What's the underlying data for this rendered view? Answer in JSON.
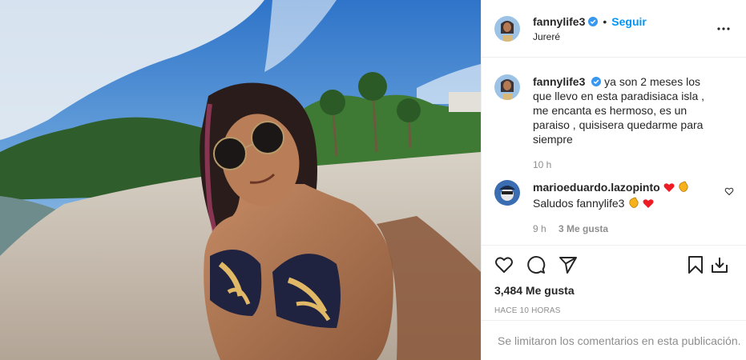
{
  "post": {
    "image_alt": "Beach selfie",
    "author": {
      "username": "fannylife3",
      "verified": true,
      "follow_label": "Seguir",
      "separator": "•",
      "location": "Jureré"
    },
    "caption": {
      "username": "fannylife3",
      "text": "ya son 2 meses los que llevo en esta paradisiaca isla , me encanta es hermoso, es un paraiso , quisisera quedarme para siempre",
      "time": "10 h"
    },
    "comments": [
      {
        "username": "marioeduardo.lazopinto",
        "text": "Saludos fannylife3",
        "time": "9 h",
        "likes": "3 Me gusta"
      }
    ],
    "likes": "3,484 Me gusta",
    "posted_ago": "HACE 10 HORAS",
    "comments_limited": "Se limitaron los comentarios en esta publicación."
  },
  "icons": {
    "more": "more-options-icon",
    "like": "heart-icon",
    "comment": "comment-icon",
    "share": "share-icon",
    "save": "bookmark-icon",
    "download": "download-icon"
  },
  "colors": {
    "accent": "#0095f6",
    "heart_emoji": "#ed1c24",
    "clap_emoji": "#f7b21b",
    "muted": "#8e8e8e"
  }
}
